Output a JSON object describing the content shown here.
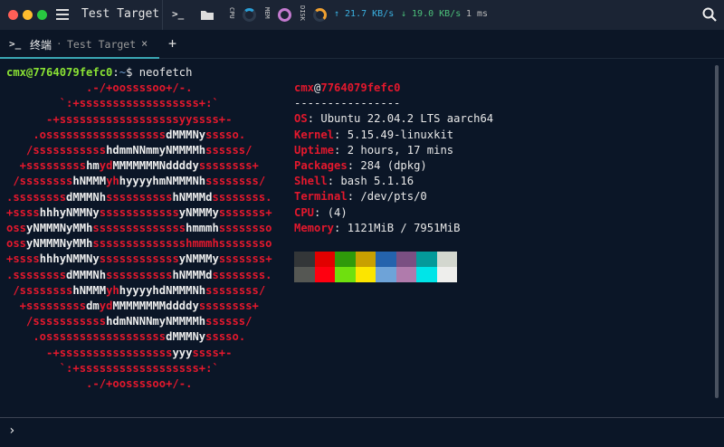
{
  "window": {
    "title": "Test Target",
    "traffic_lights": [
      "#ff5f57",
      "#febc2e",
      "#28c840"
    ]
  },
  "toolbar": {
    "terminal_icon": ">_",
    "cpu_label": "CPU",
    "mem_label": "MEM",
    "disk_label": "DISK",
    "cpu_percent": 10,
    "mem_percent": 100,
    "disk_percent": 30,
    "upload": "↑ 21.7 KB/s",
    "download": "↓ 19.0 KB/s",
    "latency": "1 ms"
  },
  "tabs": [
    {
      "label": "终端",
      "subtitle": "Test Target",
      "close": "×",
      "active": true
    }
  ],
  "new_tab": "+",
  "terminal": {
    "prompt_user": "cmx@7764079fefc0",
    "prompt_sep": ":",
    "prompt_path": "~",
    "prompt_sym": "$ ",
    "command": "neofetch",
    "logo": [
      [
        [
          "r",
          "            .-/+oossssoo+/-."
        ]
      ],
      [
        [
          "r",
          "        `:+ssssssssssssssssss+:`"
        ]
      ],
      [
        [
          "r",
          "      -+ssssssssssssssssssyyssss+-"
        ]
      ],
      [
        [
          "r",
          "    .ossssssssssssssssss"
        ],
        [
          "w",
          "dMMMNy"
        ],
        [
          "r",
          "sssso."
        ]
      ],
      [
        [
          "r",
          "   /sssssssssss"
        ],
        [
          "w",
          "hdmmNNmmyNMMMMh"
        ],
        [
          "r",
          "ssssss/"
        ]
      ],
      [
        [
          "r",
          "  +sssssssss"
        ],
        [
          "w",
          "hm"
        ],
        [
          "r",
          "yd"
        ],
        [
          "w",
          "MMMMMMMNddddy"
        ],
        [
          "r",
          "ssssssss+"
        ]
      ],
      [
        [
          "r",
          " /ssssssss"
        ],
        [
          "w",
          "hNMMM"
        ],
        [
          "r",
          "yh"
        ],
        [
          "w",
          "hyyyyhmNMMMNh"
        ],
        [
          "r",
          "ssssssss/"
        ]
      ],
      [
        [
          "r",
          ".ssssssss"
        ],
        [
          "w",
          "dMMMNh"
        ],
        [
          "r",
          "ssssssssss"
        ],
        [
          "w",
          "hNMMMd"
        ],
        [
          "r",
          "ssssssss."
        ]
      ],
      [
        [
          "r",
          "+ssss"
        ],
        [
          "w",
          "hhhyNMMNy"
        ],
        [
          "r",
          "ssssssssssss"
        ],
        [
          "w",
          "yNMMMy"
        ],
        [
          "r",
          "sssssss+"
        ]
      ],
      [
        [
          "r",
          "oss"
        ],
        [
          "w",
          "yNMMMNyMMh"
        ],
        [
          "r",
          "ssssssssssssss"
        ],
        [
          "w",
          "hmmmh"
        ],
        [
          "r",
          "ssssssso"
        ]
      ],
      [
        [
          "r",
          "oss"
        ],
        [
          "w",
          "yNMMMNyMMh"
        ],
        [
          "r",
          "sssssssssssssshmmmhssssssso"
        ]
      ],
      [
        [
          "r",
          "+ssss"
        ],
        [
          "w",
          "hhhyNMMNy"
        ],
        [
          "r",
          "ssssssssssss"
        ],
        [
          "w",
          "yNMMMy"
        ],
        [
          "r",
          "sssssss+"
        ]
      ],
      [
        [
          "r",
          ".ssssssss"
        ],
        [
          "w",
          "dMMMNh"
        ],
        [
          "r",
          "ssssssssss"
        ],
        [
          "w",
          "hNMMMd"
        ],
        [
          "r",
          "ssssssss."
        ]
      ],
      [
        [
          "r",
          " /ssssssss"
        ],
        [
          "w",
          "hNMMM"
        ],
        [
          "r",
          "yh"
        ],
        [
          "w",
          "hyyyyhdNMMMNh"
        ],
        [
          "r",
          "ssssssss/"
        ]
      ],
      [
        [
          "r",
          "  +sssssssss"
        ],
        [
          "w",
          "dm"
        ],
        [
          "r",
          "yd"
        ],
        [
          "w",
          "MMMMMMMMddddy"
        ],
        [
          "r",
          "ssssssss+"
        ]
      ],
      [
        [
          "r",
          "   /sssssssssss"
        ],
        [
          "w",
          "hdmNNNNmyNMMMMh"
        ],
        [
          "r",
          "ssssss/"
        ]
      ],
      [
        [
          "r",
          "    .ossssssssssssssssss"
        ],
        [
          "w",
          "dMMMNy"
        ],
        [
          "r",
          "sssso."
        ]
      ],
      [
        [
          "r",
          "      -+sssssssssssssssss"
        ],
        [
          "w",
          "yyy"
        ],
        [
          "r",
          "ssss+-"
        ]
      ],
      [
        [
          "r",
          "        `:+ssssssssssssssssss+:`"
        ]
      ],
      [
        [
          "r",
          "            .-/+oossssoo+/-."
        ]
      ]
    ],
    "info_user": "cmx",
    "info_at": "@",
    "info_host": "7764079fefc0",
    "info_rule": "----------------",
    "info": [
      {
        "key": "OS",
        "value": "Ubuntu 22.04.2 LTS aarch64"
      },
      {
        "key": "Kernel",
        "value": "5.15.49-linuxkit"
      },
      {
        "key": "Uptime",
        "value": "2 hours, 17 mins"
      },
      {
        "key": "Packages",
        "value": "284 (dpkg)"
      },
      {
        "key": "Shell",
        "value": "bash 5.1.16"
      },
      {
        "key": "Terminal",
        "value": "/dev/pts/0"
      },
      {
        "key": "CPU",
        "value": "(4)"
      },
      {
        "key": "Memory",
        "value": "1121MiB / 7951MiB"
      }
    ],
    "palette_normal": [
      "#333638",
      "#e20000",
      "#2f9a0a",
      "#c8a000",
      "#2463ad",
      "#7a4f82",
      "#049a9a",
      "#d3d7cf"
    ],
    "palette_bright": [
      "#555753",
      "#ff0010",
      "#6fe00f",
      "#fce500",
      "#6ea3d8",
      "#b07bac",
      "#00e5e8",
      "#eeeeec"
    ],
    "input_prompt": "›"
  }
}
